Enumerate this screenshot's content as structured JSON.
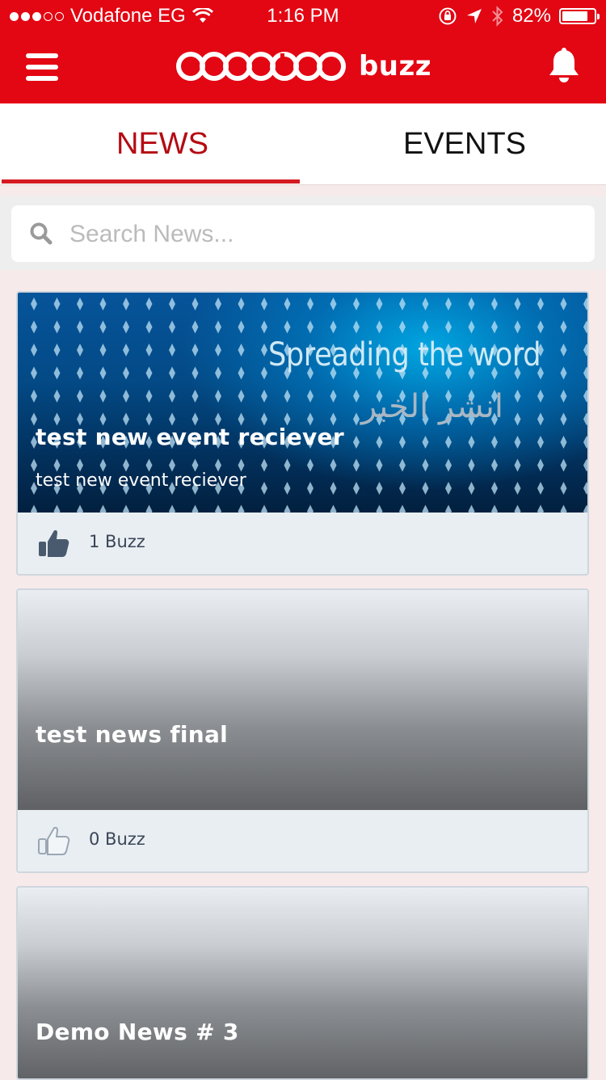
{
  "status_bar": {
    "carrier": "Vodafone EG",
    "time": "1:16 PM",
    "battery": "82%",
    "battery_level": 0.82
  },
  "header": {
    "logo_word": "ooredoo",
    "logo_sub": "buzz"
  },
  "tabs": [
    {
      "label": "NEWS",
      "active": true
    },
    {
      "label": "EVENTS",
      "active": false
    }
  ],
  "search": {
    "placeholder": "Search News..."
  },
  "cards": [
    {
      "title": "test new event reciever",
      "subtitle": "test new event reciever",
      "banner_text_en": "Spreading the word",
      "banner_text_ar": "انشر الخبر",
      "buzz": "1 Buzz",
      "liked": true
    },
    {
      "title": "test news final",
      "buzz": "0 Buzz",
      "liked": false
    },
    {
      "title": "Demo News # 3"
    }
  ],
  "colors": {
    "brand_red": "#e30613",
    "active_tab": "#b50a12"
  }
}
